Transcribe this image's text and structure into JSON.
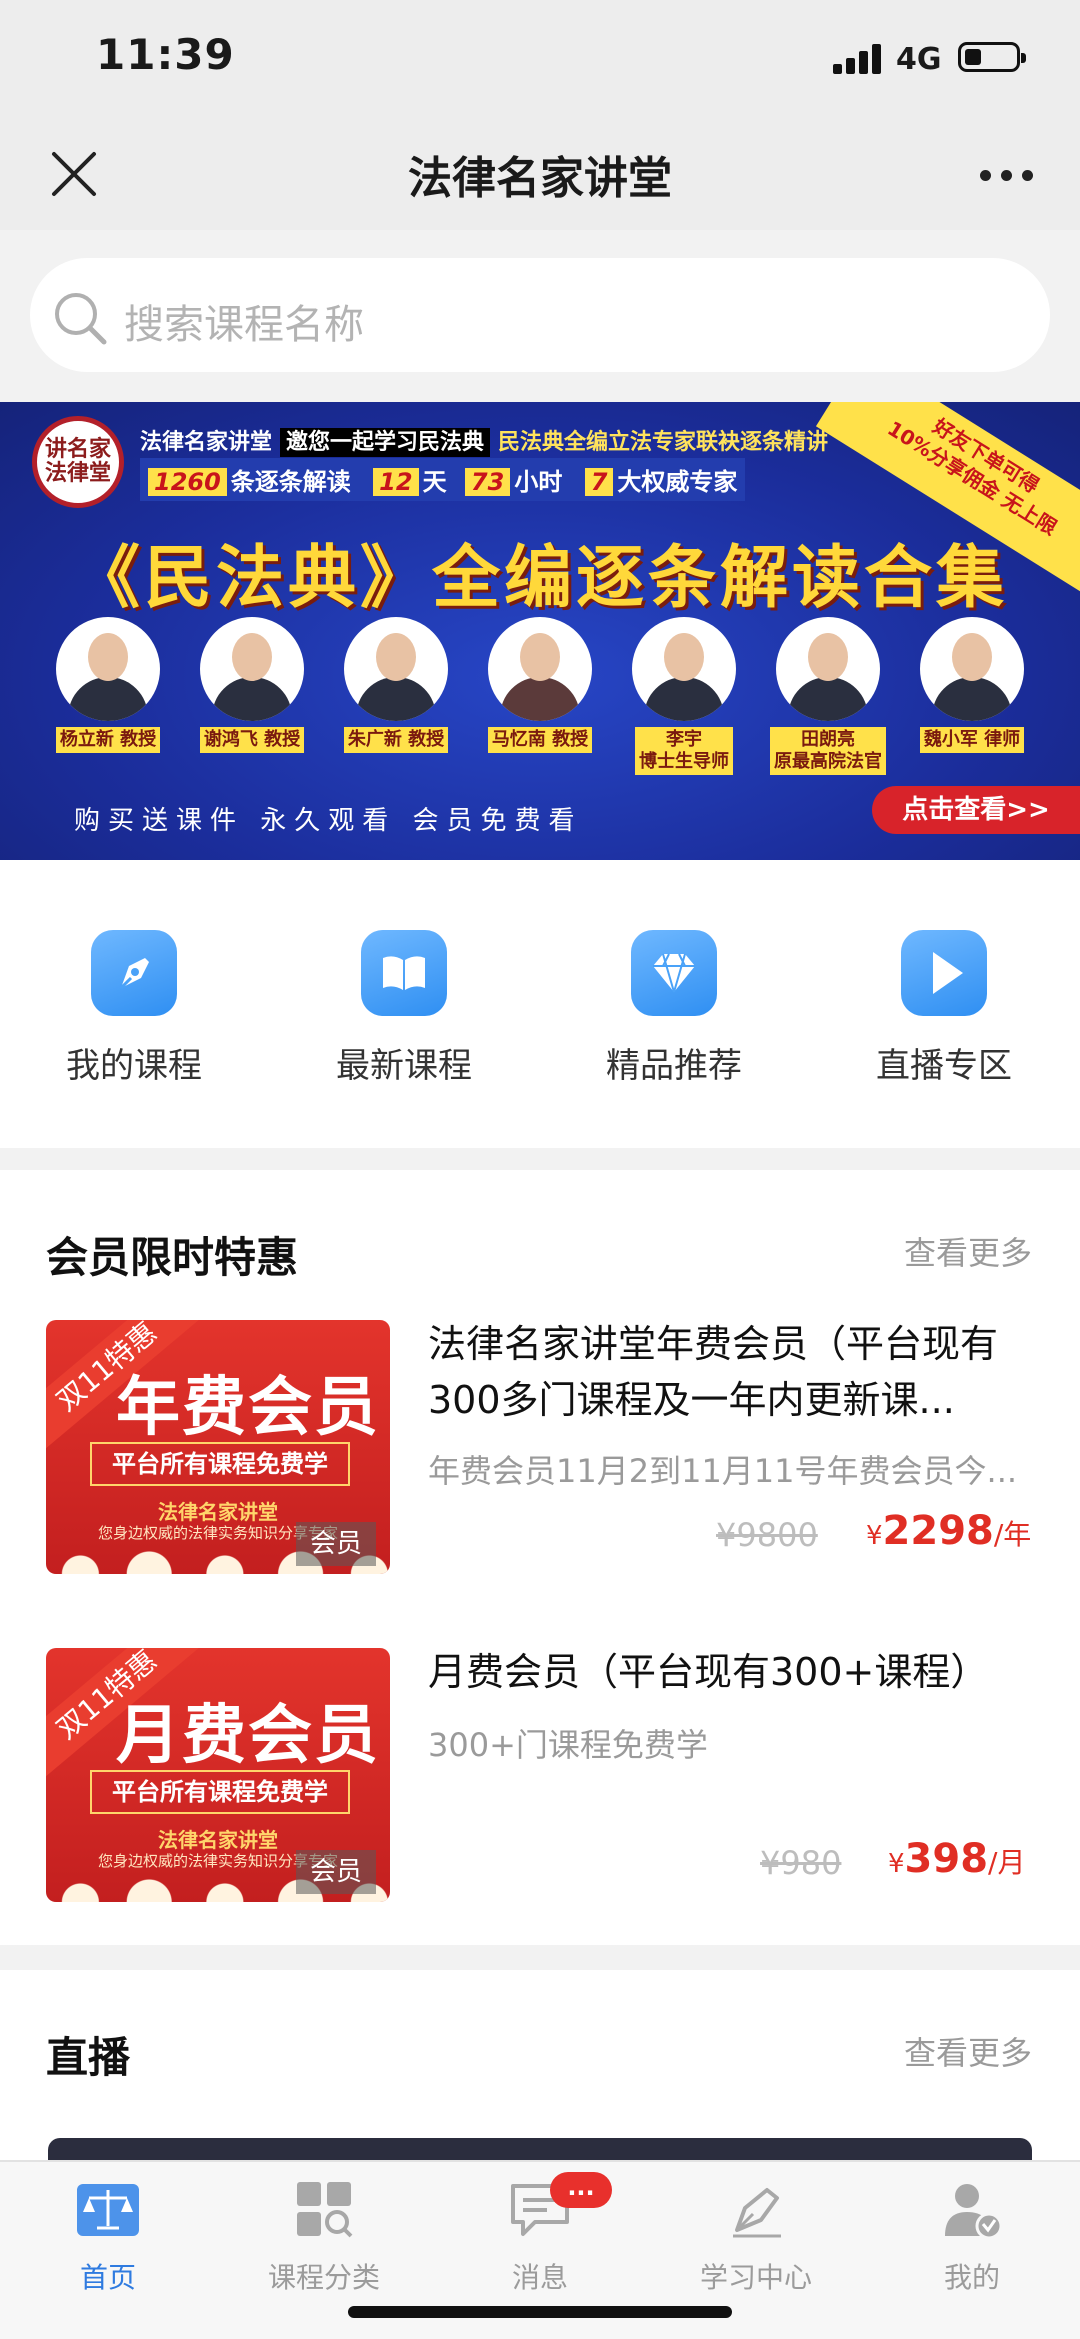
{
  "status_bar": {
    "time": "11:39",
    "network": "4G"
  },
  "nav": {
    "title": "法律名家讲堂"
  },
  "search": {
    "placeholder": "搜索课程名称"
  },
  "banner": {
    "logo_text": "讲名家法律堂",
    "line1_a": "法律名家讲堂",
    "line1_highlight": "邀您一起学习民法典",
    "line1_b": "民法典全编立法专家联袂逐条精讲",
    "stat_items": "条逐条解读",
    "stat_items_num": "1260",
    "stat_days_num": "12",
    "stat_days": "天",
    "stat_hours_num": "73",
    "stat_hours": "小时",
    "stat_experts_num": "7",
    "stat_experts": "大权威专家",
    "corner_line1": "好友下单可得",
    "corner_line2": "10%分享佣金 无上限",
    "title": "《民法典》全编逐条解读合集",
    "experts": [
      {
        "name": "杨立新 教授"
      },
      {
        "name": "谢鸿飞 教授"
      },
      {
        "name": "朱广新 教授"
      },
      {
        "name": "马忆南 教授"
      },
      {
        "name": "李宇",
        "sub": "博士生导师"
      },
      {
        "name": "田朗亮",
        "sub": "原最高院法官"
      },
      {
        "name": "魏小军 律师"
      }
    ],
    "slogan": "购买送课件 永久观看 会员免费看",
    "cta": "点击查看>>"
  },
  "quick_nav": [
    {
      "label": "我的课程",
      "icon": "pen-icon"
    },
    {
      "label": "最新课程",
      "icon": "book-icon"
    },
    {
      "label": "精品推荐",
      "icon": "diamond-icon"
    },
    {
      "label": "直播专区",
      "icon": "play-icon"
    }
  ],
  "member_section": {
    "title": "会员限时特惠",
    "more": "查看更多",
    "courses": [
      {
        "thumb_sash": "双11特惠",
        "thumb_big": "年费会员",
        "thumb_box": "平台所有课程免费学",
        "thumb_brand": "法律名家讲堂",
        "thumb_tag": "您身边权威的法律实务知识分享专家",
        "thumb_badge": "会员",
        "title": "法律名家讲堂年费会员（平台现有300多门课程及一年内更新课...",
        "subtitle": "年费会员11月2到11月11号年费会员今...",
        "old_price": "¥9800",
        "currency": "¥",
        "price": "2298",
        "unit": "/年"
      },
      {
        "thumb_sash": "双11特惠",
        "thumb_big": "月费会员",
        "thumb_box": "平台所有课程免费学",
        "thumb_brand": "法律名家讲堂",
        "thumb_tag": "您身边权威的法律实务知识分享专家",
        "thumb_badge": "会员",
        "title": "月费会员（平台现有300+课程）",
        "subtitle": "300+门课程免费学",
        "old_price": "¥980",
        "currency": "¥",
        "price": "398",
        "unit": "/月"
      }
    ]
  },
  "live_section": {
    "title": "直播",
    "more": "查看更多"
  },
  "tab_bar": {
    "tabs": [
      {
        "label": "首页",
        "icon": "home-icon",
        "active": true
      },
      {
        "label": "课程分类",
        "icon": "category-icon"
      },
      {
        "label": "消息",
        "icon": "message-icon"
      },
      {
        "label": "学习中心",
        "icon": "study-icon"
      },
      {
        "label": "我的",
        "icon": "profile-icon"
      }
    ],
    "message_badge": "..."
  },
  "colors": {
    "accent": "#2f7be0",
    "price": "#e02e24",
    "banner_bg": "#1b2d9b",
    "banner_gold": "#ffd83a"
  }
}
